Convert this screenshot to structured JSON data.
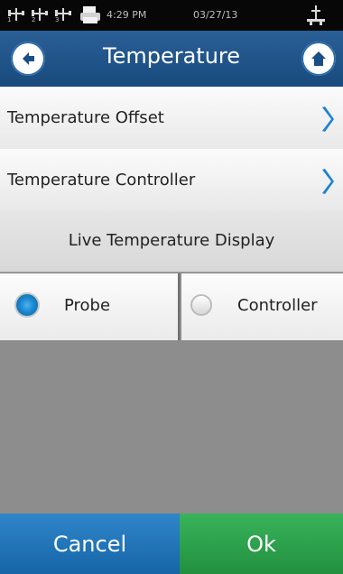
{
  "status_bar": {
    "time": "4:29 PM",
    "date": "03/27/13",
    "usb_ports": [
      "1",
      "2",
      "3"
    ]
  },
  "header": {
    "title": "Temperature"
  },
  "menu": {
    "items": [
      {
        "label": "Temperature Offset"
      },
      {
        "label": "Temperature Controller"
      }
    ]
  },
  "section": {
    "title": "Live Temperature Display"
  },
  "display_source": {
    "options": [
      {
        "label": "Probe",
        "selected": true
      },
      {
        "label": "Controller",
        "selected": false
      }
    ]
  },
  "footer": {
    "cancel": "Cancel",
    "ok": "Ok"
  },
  "colors": {
    "header": "#1f568d",
    "cancel": "#1e6fb4",
    "ok": "#2c9f49",
    "radio_selected": "#1b88cf"
  }
}
